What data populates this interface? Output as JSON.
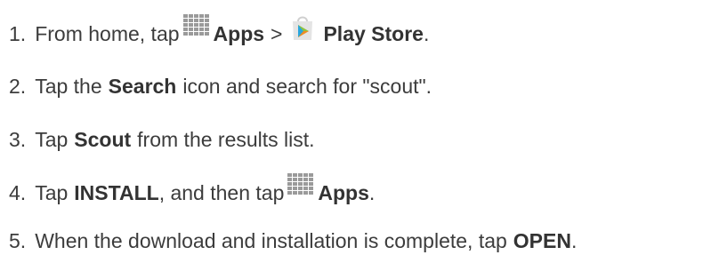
{
  "steps": [
    {
      "number": "1.",
      "t1": "From home, tap",
      "apps_icon": "apps-grid-icon",
      "b1": "Apps",
      "sep": ">",
      "play_icon": "play-store-icon",
      "b2": "Play Store",
      "end": "."
    },
    {
      "number": "2.",
      "t1": "Tap the",
      "b1": "Search",
      "t2": "icon and search for \"scout\"."
    },
    {
      "number": "3.",
      "t1": "Tap",
      "b1": "Scout",
      "t2": "from the results list."
    },
    {
      "number": "4.",
      "t1": "Tap",
      "b1": "INSTALL",
      "t2": ", and then tap",
      "apps_icon": "apps-grid-icon",
      "b2": "Apps",
      "end": "."
    },
    {
      "number": "5.",
      "t1": "When the download and installation is complete, tap",
      "b1": "OPEN",
      "end": "."
    }
  ],
  "colors": {
    "text": "#3c3c3c",
    "icon_gray": "#9a9a9a",
    "play_green": "#8fc43d",
    "play_blue": "#29a6de",
    "play_orange": "#f08a24",
    "play_bag": "#e4e4e4"
  }
}
